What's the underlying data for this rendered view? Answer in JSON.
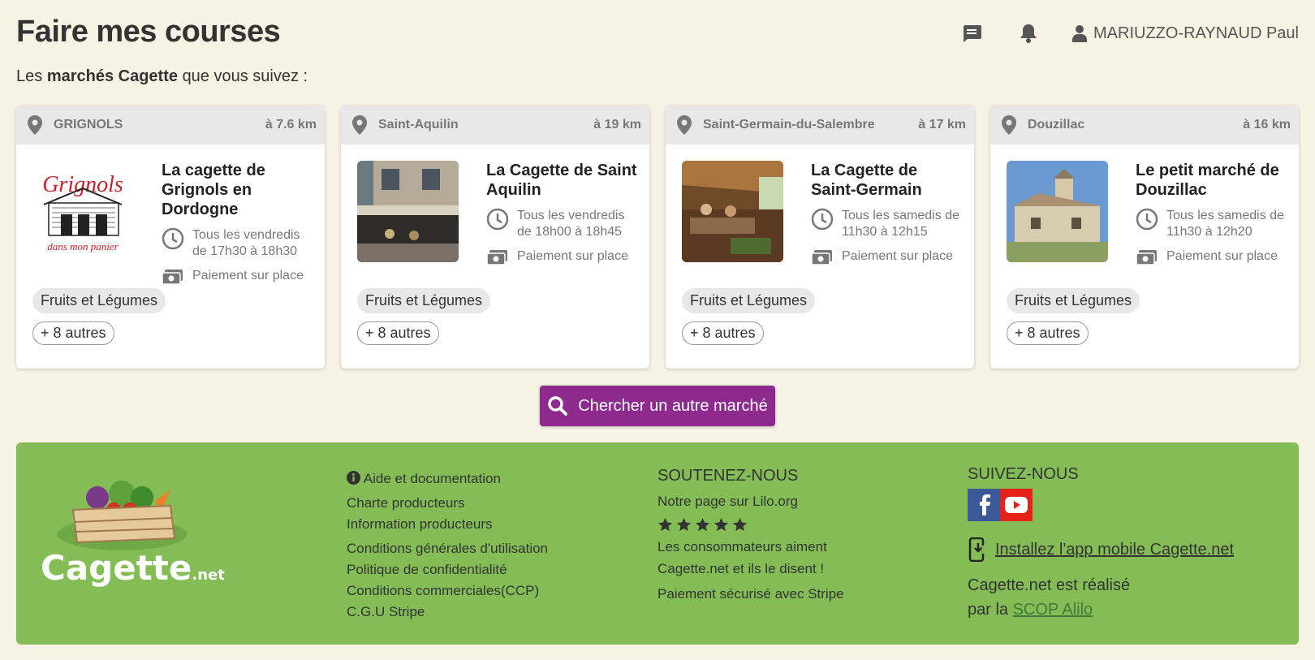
{
  "header": {
    "title": "Faire mes courses",
    "user_name": "MARIUZZO-RAYNAUD Paul"
  },
  "subtitle": {
    "prefix": "Les",
    "bold": "marchés Cagette",
    "suffix": "que vous suivez :"
  },
  "markets": [
    {
      "city": "GRIGNOLS",
      "distance": "à 7.6 km",
      "name": "La cagette de Grignols en Dordogne",
      "schedule": "Tous les vendredis de 17h30 à 18h30",
      "payment": "Paiement sur place",
      "tag": "Fruits et Légumes",
      "more": "+ 8 autres",
      "logo_text_top": "Grignols",
      "logo_text_bottom": "dans mon panier"
    },
    {
      "city": "Saint-Aquilin",
      "distance": "à 19 km",
      "name": "La Cagette de Saint Aquilin",
      "schedule": "Tous les vendredis de 18h00 à 18h45",
      "payment": "Paiement sur place",
      "tag": "Fruits et Légumes",
      "more": "+ 8 autres"
    },
    {
      "city": "Saint-Germain-du-Salembre",
      "distance": "à 17 km",
      "name": "La Cagette de Saint-Germain",
      "schedule": "Tous les samedis de 11h30 à 12h15",
      "payment": "Paiement sur place",
      "tag": "Fruits et Légumes",
      "more": "+ 8 autres"
    },
    {
      "city": "Douzillac",
      "distance": "à 16 km",
      "name": "Le petit marché de Douzillac",
      "schedule": "Tous les samedis de 11h30 à 12h20",
      "payment": "Paiement sur place",
      "tag": "Fruits et Légumes",
      "more": "+ 8 autres"
    }
  ],
  "search_button": "Chercher un autre marché",
  "footer": {
    "logo_main": "Cagette",
    "logo_suffix": ".net",
    "links": [
      "Aide et documentation",
      "Charte producteurs",
      "Information producteurs",
      "Conditions générales d'utilisation",
      "Politique de confidentialité",
      "Conditions commerciales(CCP)",
      "C.G.U Stripe"
    ],
    "support_title": "SOUTENEZ-NOUS",
    "lilo": "Notre page sur Lilo.org",
    "consumers_line1": "Les consommateurs aiment",
    "consumers_line2": "Cagette.net et ils le disent !",
    "stripe": "Paiement sécurisé avec Stripe",
    "follow_title": "SUIVEZ-NOUS",
    "app_link": "Installez l'app mobile Cagette.net",
    "made_by_line1": "Cagette.net est réalisé",
    "made_by_prefix": "par la",
    "made_by_link": "SCOP Alilo"
  },
  "colors": {
    "background": "#f6f2e4",
    "accent": "#8e2a8e",
    "footer": "#84bd55",
    "facebook": "#3b5998",
    "youtube": "#e62117"
  }
}
